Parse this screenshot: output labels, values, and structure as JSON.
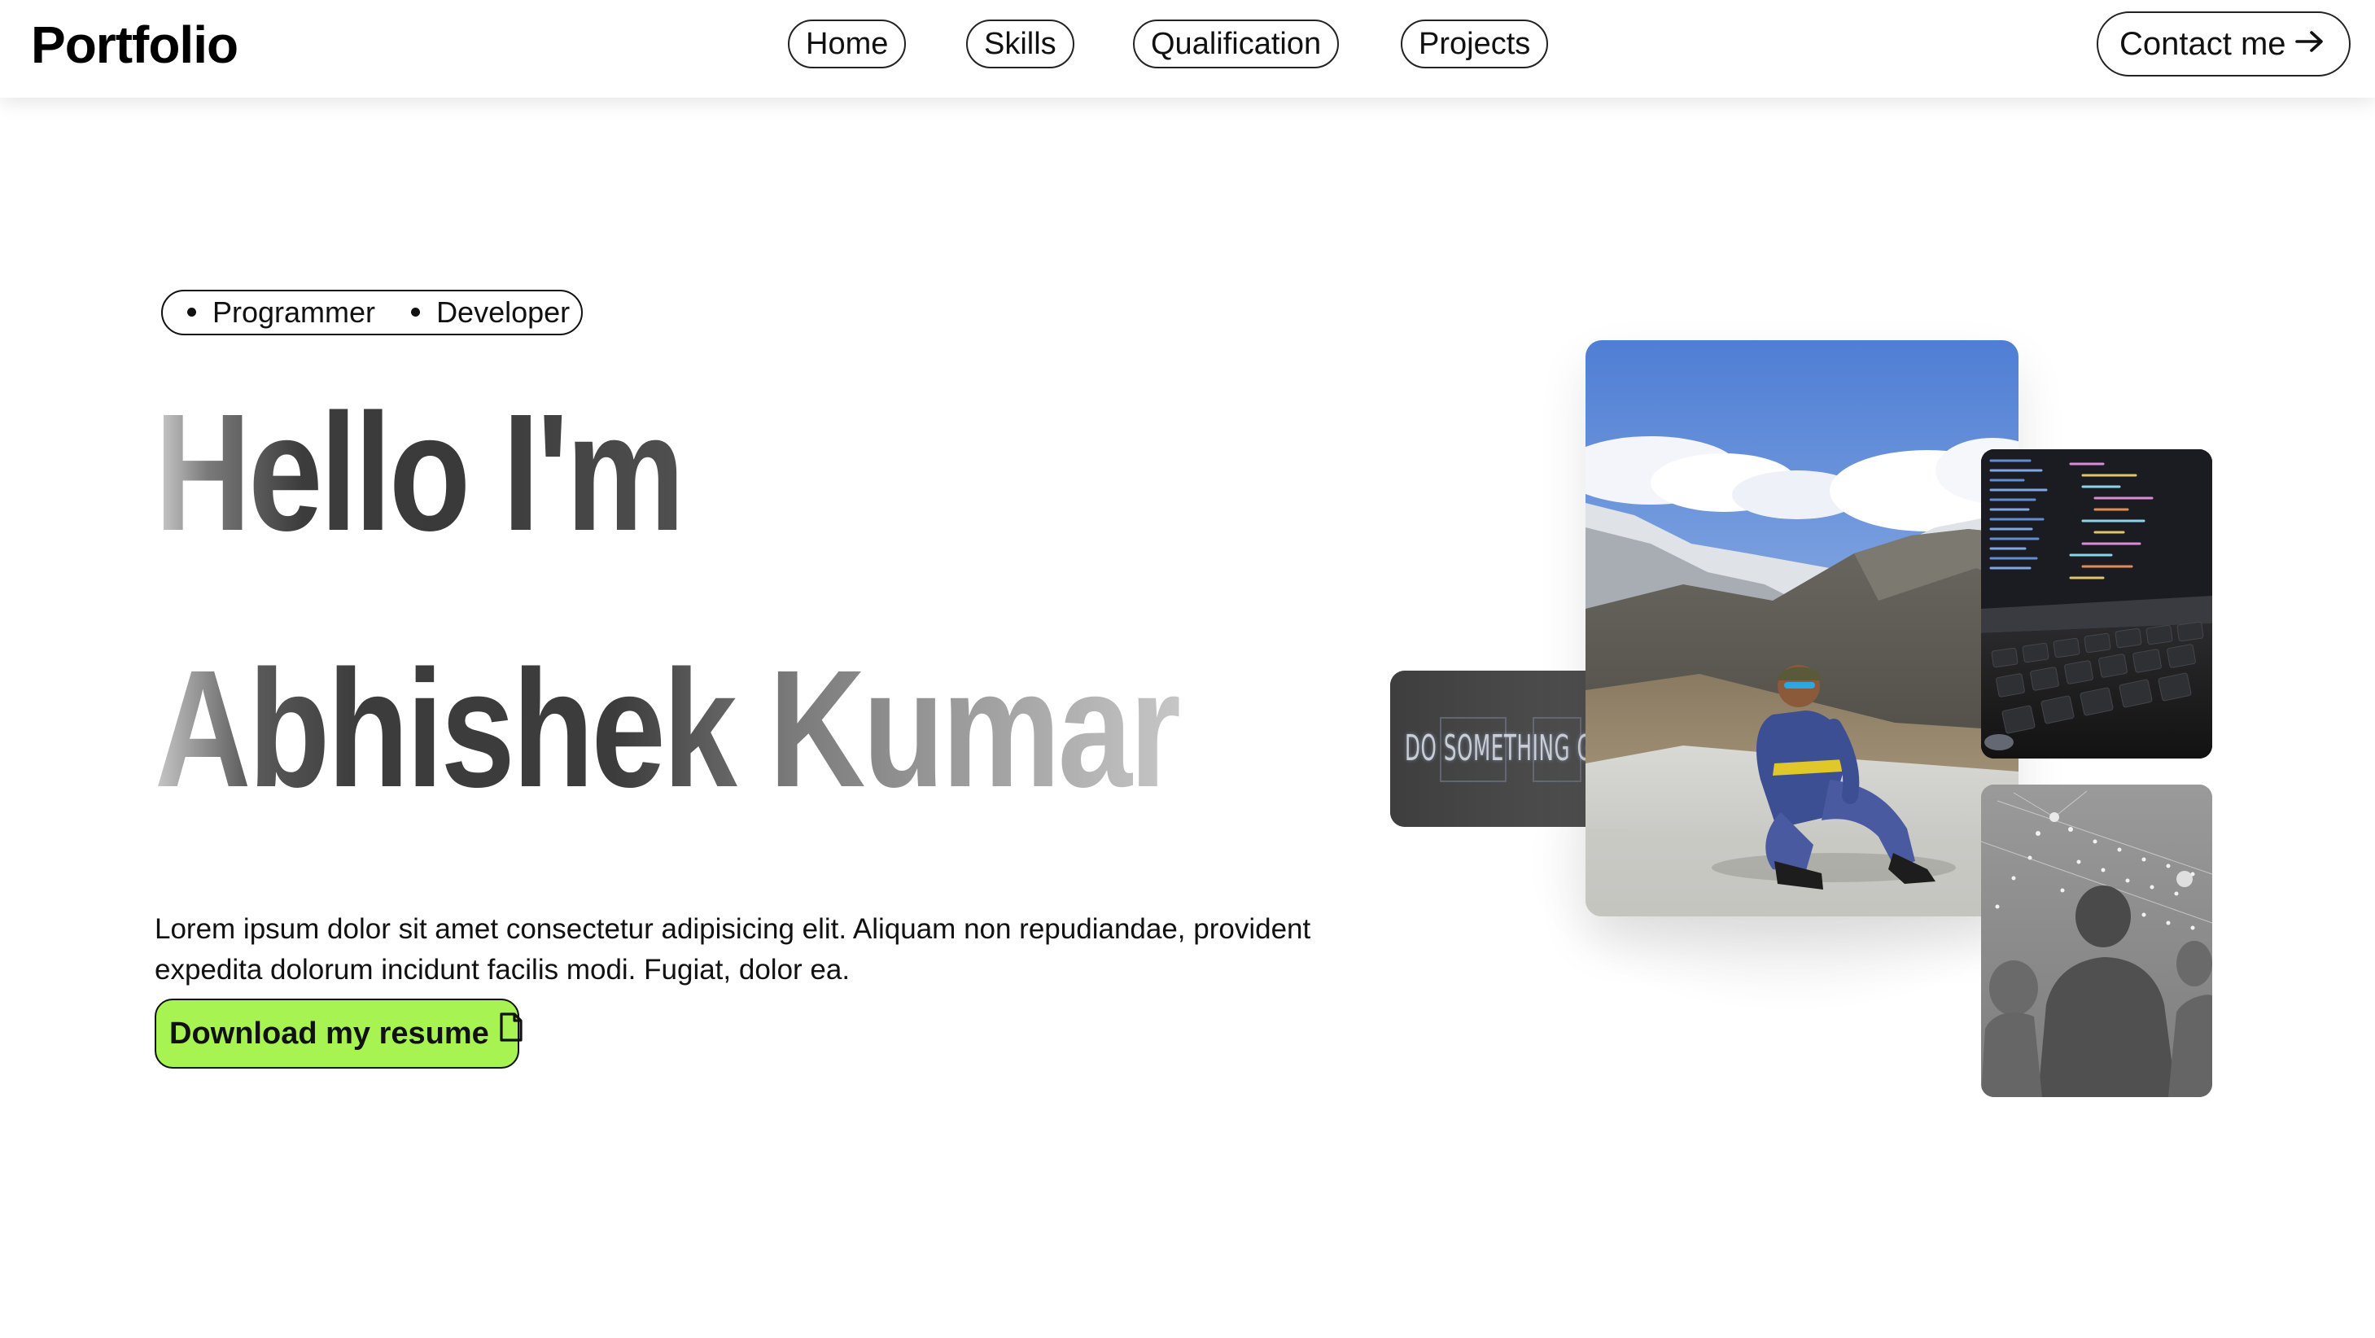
{
  "brand": {
    "logo": "Portfolio"
  },
  "nav": {
    "links": [
      {
        "label": "Home"
      },
      {
        "label": "Skills"
      },
      {
        "label": "Qualification"
      },
      {
        "label": "Projects"
      }
    ],
    "contact_label": "Contact me",
    "contact_icon": "arrow-right-icon"
  },
  "hero": {
    "roles": [
      "Programmer",
      "Developer"
    ],
    "greeting": "Hello I'm",
    "name": "Abhishek Kumar",
    "description": "Lorem ipsum dolor sit amet consectetur adipisicing elit. Aliquam non repudiandae, provident expedita dolorum incidunt facilis modi. Fugiat, dolor ea.",
    "resume_label": "Download my resume",
    "resume_icon": "file-icon"
  },
  "gallery": {
    "quote_card_text": "DO SOMETHING GREAT",
    "images": [
      "mountain-portrait-photo",
      "laptop-code-photo",
      "crowd-lights-photo",
      "neon-sign-photo"
    ]
  },
  "colors": {
    "accent": "#a6f352",
    "text": "#111111",
    "background": "#ffffff"
  }
}
